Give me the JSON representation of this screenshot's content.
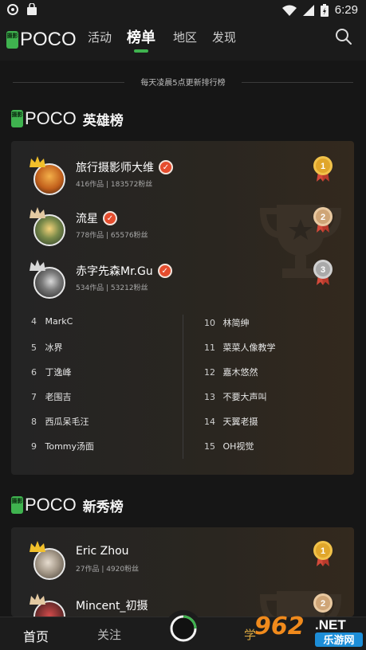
{
  "status_bar": {
    "time": "6:29"
  },
  "nav": {
    "logo_badge": "摄影",
    "logo_text": "POCO",
    "tabs": [
      {
        "label": "活动",
        "active": false
      },
      {
        "label": "榜单",
        "active": true
      },
      {
        "label": "地区",
        "active": false
      },
      {
        "label": "发现",
        "active": false
      }
    ],
    "accent_color": "#3fb34f"
  },
  "notice": "每天凌晨5点更新排行榜",
  "hero_board": {
    "logo_text": "POCO",
    "title": "英雄榜",
    "top3": [
      {
        "name": "旅行摄影师大维",
        "stats": "416作品 | 183572粉丝",
        "medal": "1",
        "verified": true
      },
      {
        "name": "流星",
        "stats": "778作品 | 65576粉丝",
        "medal": "2",
        "verified": true
      },
      {
        "name": "赤字先森Mr.Gu",
        "stats": "534作品 | 53212粉丝",
        "medal": "3",
        "verified": true
      }
    ],
    "left_list": [
      {
        "rank": "4",
        "name": "MarkC"
      },
      {
        "rank": "5",
        "name": "冰界"
      },
      {
        "rank": "6",
        "name": "丁逸峰"
      },
      {
        "rank": "7",
        "name": "老围吉"
      },
      {
        "rank": "8",
        "name": "西瓜呆毛汪"
      },
      {
        "rank": "9",
        "name": "Tommy汤面"
      }
    ],
    "right_list": [
      {
        "rank": "10",
        "name": "林简绅"
      },
      {
        "rank": "11",
        "name": "菜菜人像教学"
      },
      {
        "rank": "12",
        "name": "嘉木悠然"
      },
      {
        "rank": "13",
        "name": "不要大声叫"
      },
      {
        "rank": "14",
        "name": "天翼老摄"
      },
      {
        "rank": "15",
        "name": "OH视觉"
      }
    ]
  },
  "new_board": {
    "logo_text": "POCO",
    "title": "新秀榜",
    "top": [
      {
        "name": "Eric Zhou",
        "stats": "27作品 | 4920粉丝",
        "medal": "1"
      },
      {
        "name": "Mincent_初摄",
        "stats": "",
        "medal": "2"
      }
    ]
  },
  "bottom_nav": {
    "items": [
      {
        "label": "首页",
        "active": true
      },
      {
        "label": "关注",
        "active": false
      },
      {
        "label": "学",
        "active": false
      }
    ]
  },
  "watermark": {
    "number": "962",
    "dot_net": ".NET",
    "site": "乐游网"
  }
}
